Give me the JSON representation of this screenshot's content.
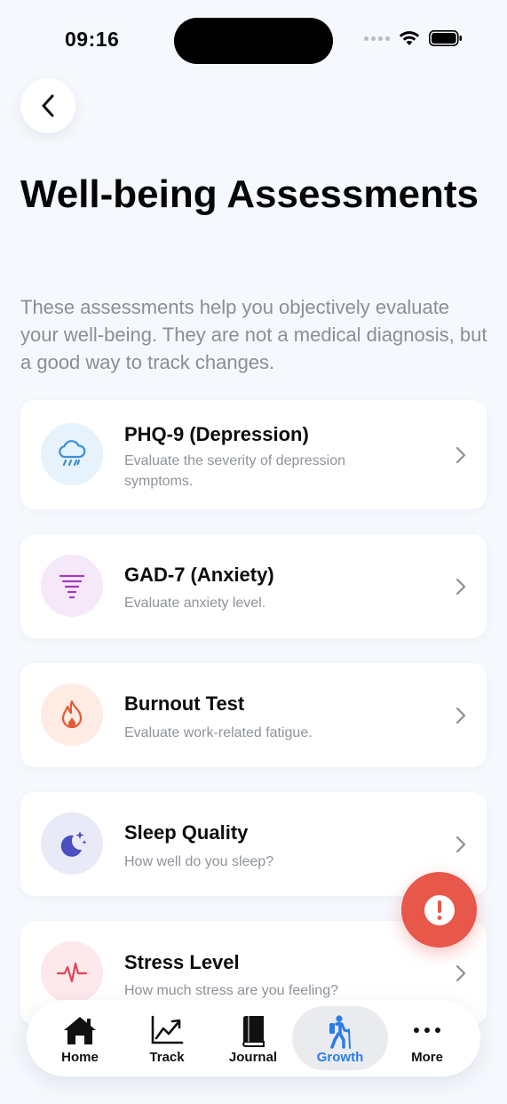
{
  "status_bar": {
    "time": "09:16"
  },
  "page": {
    "title": "Well-being Assessments",
    "description": "These assessments help you objectively evaluate your well-being. They are not a medical diagnosis, but a good way to track changes."
  },
  "assessments": [
    {
      "title": "PHQ-9 (Depression)",
      "subtitle": "Evaluate the severity of depression symptoms.",
      "icon": "rain-cloud-icon",
      "color": "#3a8fd6",
      "bg": "#e6f2fc"
    },
    {
      "title": "GAD-7 (Anxiety)",
      "subtitle": "Evaluate anxiety level.",
      "icon": "tornado-icon",
      "color": "#a33bb8",
      "bg": "#f5e8f8"
    },
    {
      "title": "Burnout Test",
      "subtitle": "Evaluate work-related fatigue.",
      "icon": "flame-icon",
      "color": "#e45a32",
      "bg": "#fdebe4"
    },
    {
      "title": "Sleep Quality",
      "subtitle": "How well do you sleep?",
      "icon": "moon-stars-icon",
      "color": "#4a4fc2",
      "bg": "#e9eaf8"
    },
    {
      "title": "Stress Level",
      "subtitle": "How much stress are you feeling?",
      "icon": "heartbeat-icon",
      "color": "#e0425a",
      "bg": "#fde8ec"
    }
  ],
  "tabs": [
    {
      "label": "Home",
      "icon": "house-icon",
      "active": false
    },
    {
      "label": "Track",
      "icon": "trend-chart-icon",
      "active": false
    },
    {
      "label": "Journal",
      "icon": "book-icon",
      "active": false
    },
    {
      "label": "Growth",
      "icon": "hiker-icon",
      "active": true
    },
    {
      "label": "More",
      "icon": "ellipsis-icon",
      "active": false
    }
  ],
  "colors": {
    "accent": "#2b7de9",
    "fab": "#e7574a"
  }
}
